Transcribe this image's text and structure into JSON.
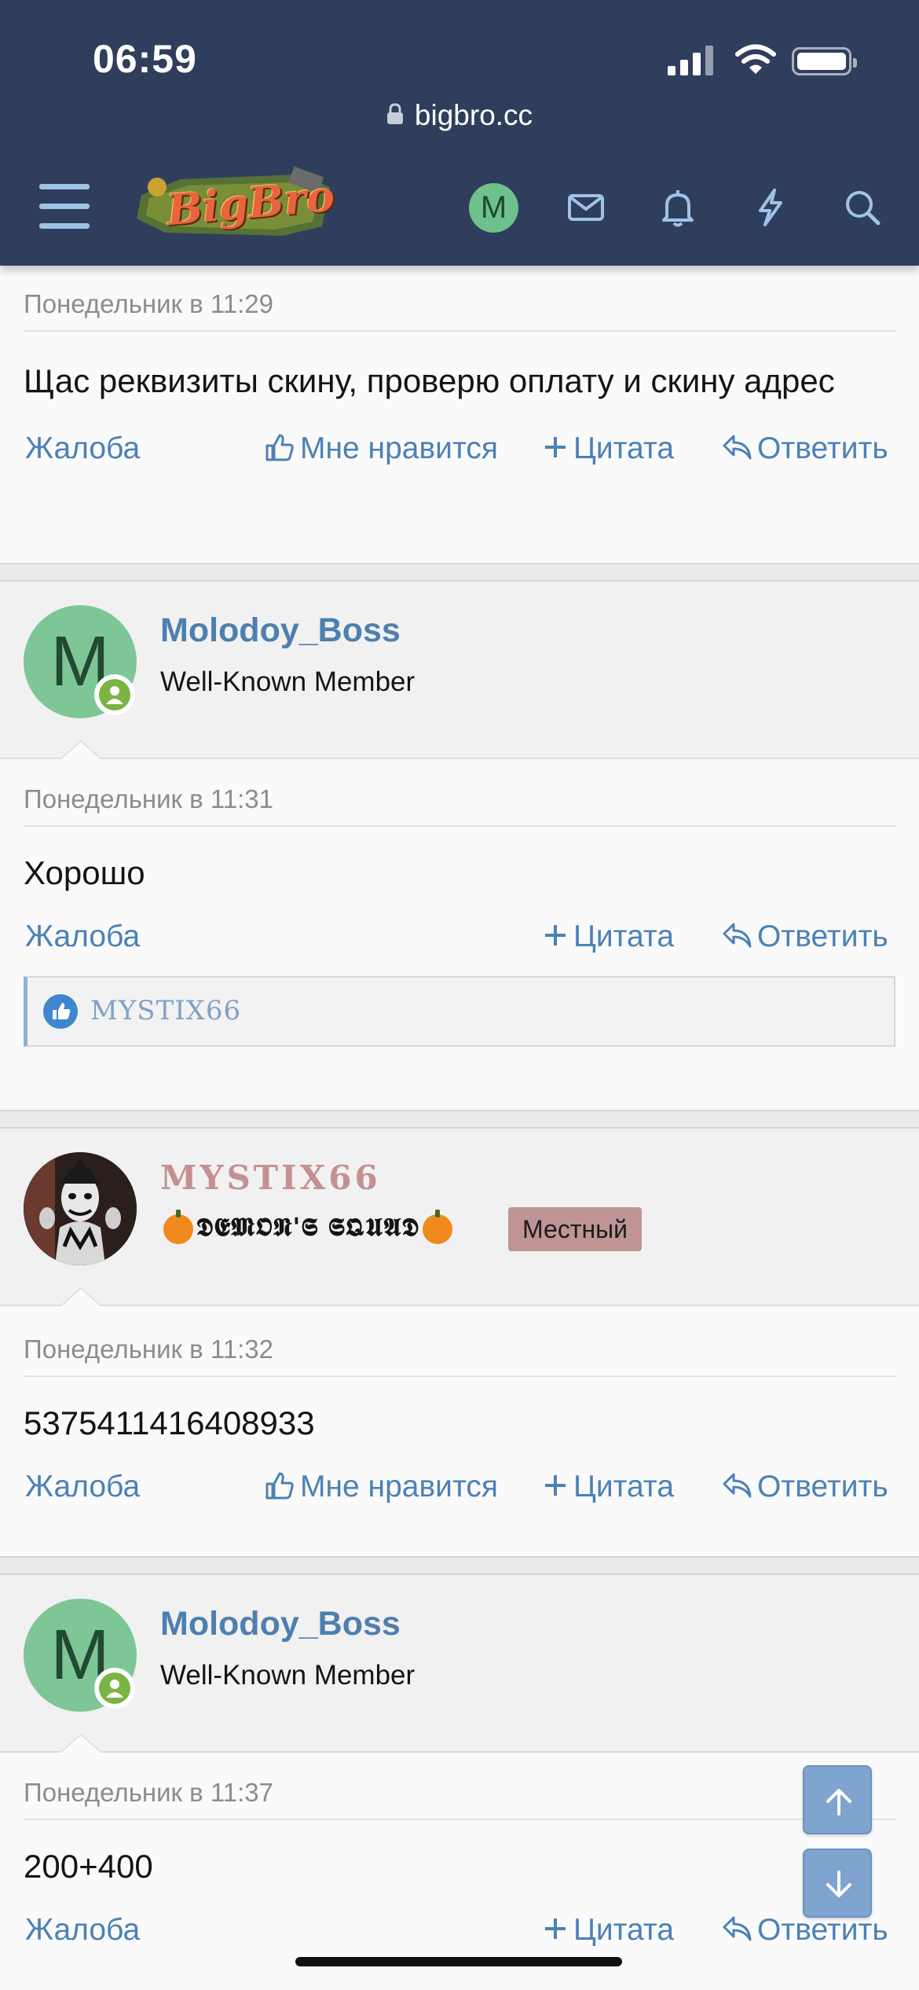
{
  "status_bar": {
    "time": "06:59"
  },
  "browser": {
    "url": "bigbro.cc"
  },
  "nav": {
    "logo_text": "BigBro",
    "user_initial": "M"
  },
  "posts": [
    {
      "date": "Понедельник в 11:29",
      "text": "Щас реквизиты скину, проверю оплату и скину адрес",
      "actions": {
        "report": "Жалоба",
        "like": "Мне нравится",
        "quote": "Цитата",
        "reply": "Ответить"
      }
    },
    {
      "author": {
        "name": "Molodoy_Boss",
        "initial": "M",
        "title": "Well-Known Member"
      },
      "date": "Понедельник в 11:31",
      "text": "Хорошо",
      "actions": {
        "report": "Жалоба",
        "quote": "Цитата",
        "reply": "Ответить"
      },
      "likes": "MYSTIX66"
    },
    {
      "author": {
        "name": "MYSTIX66",
        "title": "𝕯𝕰𝕸𝕺𝕹'𝕾 𝕾𝕼𝖀𝕬𝕯",
        "badge": "Местный"
      },
      "date": "Понедельник в 11:32",
      "text": "5375411416408933",
      "actions": {
        "report": "Жалоба",
        "like": "Мне нравится",
        "quote": "Цитата",
        "reply": "Ответить"
      }
    },
    {
      "author": {
        "name": "Molodoy_Boss",
        "initial": "M",
        "title": "Well-Known Member"
      },
      "date": "Понедельник в 11:37",
      "text": "200+400",
      "actions": {
        "report": "Жалоба",
        "quote": "Цитата",
        "reply": "Ответить"
      }
    }
  ],
  "colors": {
    "header": "#2f3e5c",
    "link": "#4b81b6",
    "author": "#4e7fae",
    "badge": "#c09494"
  }
}
